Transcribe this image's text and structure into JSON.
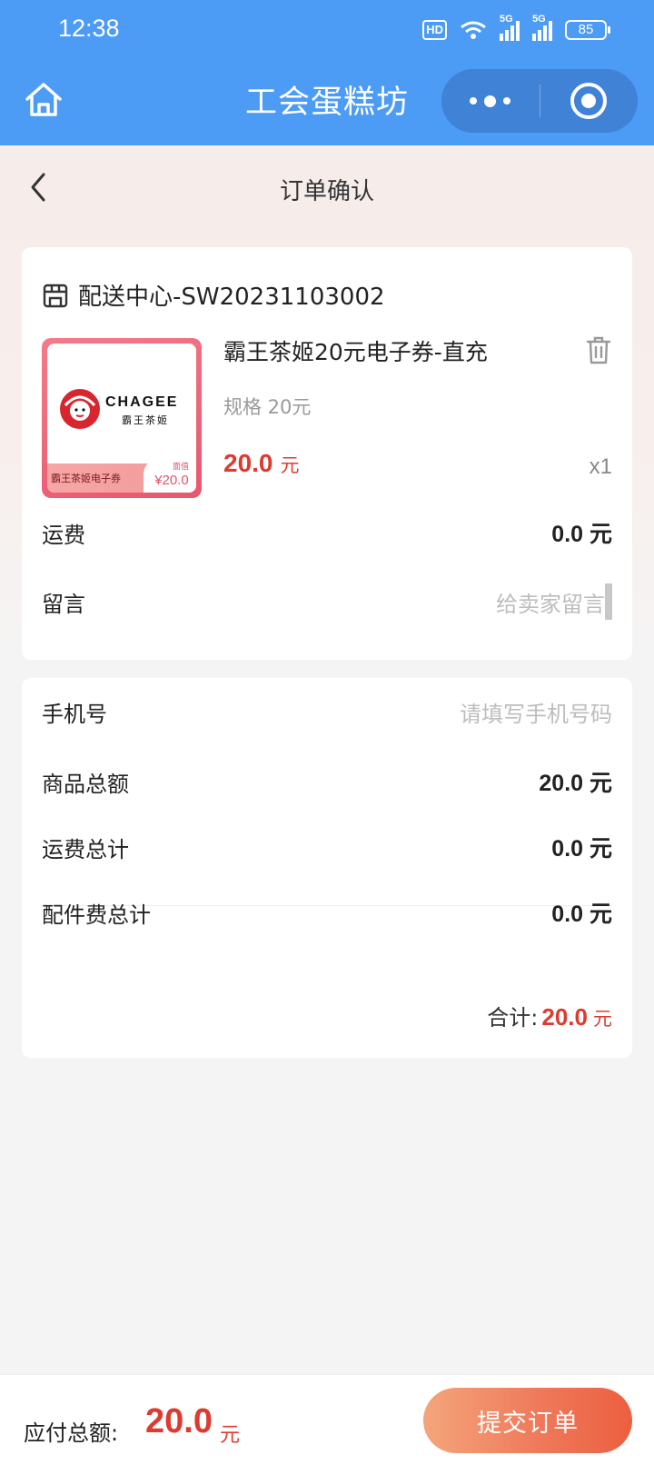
{
  "status_bar": {
    "time": "12:38",
    "hd_badge": "HD",
    "signal1_tag": "5G",
    "signal2_tag": "5G",
    "battery": "85"
  },
  "header": {
    "title": "工会蛋糕坊",
    "home_icon": "home-icon",
    "more_icon": "more-dots-icon",
    "close_icon": "target-close-icon",
    "color": "#4c9bf5"
  },
  "nav": {
    "back_icon": "chevron-left-icon",
    "title": "订单确认"
  },
  "order": {
    "shop_icon": "store-icon",
    "shop_name": "配送中心-SW20231103002",
    "product": {
      "name": "霸王茶姬20元电子券-直充",
      "spec": "规格 20元",
      "price": "20.0",
      "price_unit": "元",
      "quantity": "x1",
      "image": {
        "brand": "CHAGEE",
        "brand_cn": "霸王茶姬",
        "band_text": "霸王茶姬电子券",
        "badge_small": "面值",
        "badge_price": "¥20.0"
      }
    },
    "shipping": {
      "label": "运费",
      "value": "0.0 元"
    },
    "message": {
      "label": "留言",
      "placeholder": "给卖家留言"
    }
  },
  "summary": {
    "phone": {
      "label": "手机号",
      "placeholder": "请填写手机号码"
    },
    "goods_total": {
      "label": "商品总额",
      "value": "20.0 元"
    },
    "shipping_total": {
      "label": "运费总计",
      "value": "0.0 元"
    },
    "accessory_total": {
      "label": "配件费总计",
      "value": "0.0 元"
    },
    "total": {
      "label": "合计:",
      "amount": "20.0",
      "unit": "元"
    }
  },
  "bottom": {
    "pay_label": "应付总额:",
    "pay_amount": "20.0",
    "pay_unit": "元",
    "submit_label": "提交订单"
  },
  "colors": {
    "price_red": "#dc3b30",
    "submit_gradient_start": "#f4a57b",
    "submit_gradient_end": "#eb5f3f"
  }
}
